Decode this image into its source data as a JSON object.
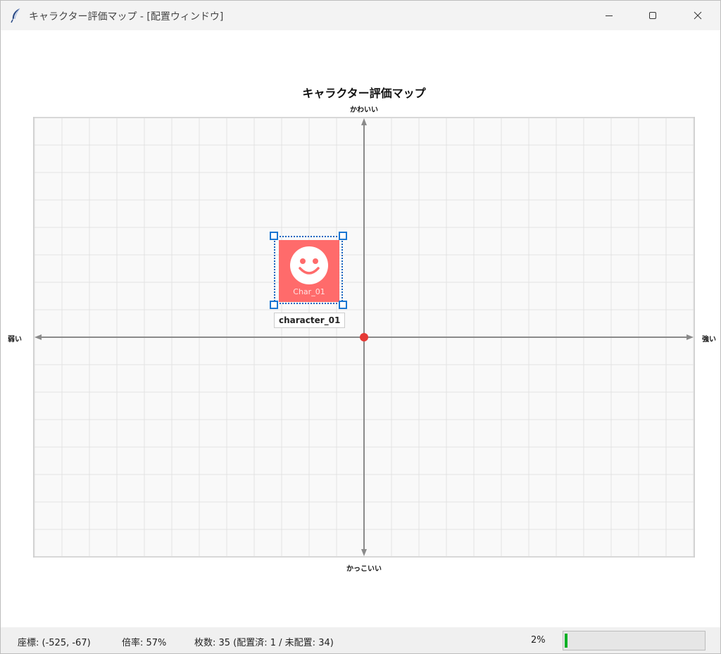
{
  "window": {
    "title": "キャラクター評価マップ - [配置ウィンドウ]",
    "icon": "feather-icon",
    "controls": [
      "minimize-icon",
      "maximize-icon",
      "close-icon"
    ]
  },
  "map": {
    "title": "キャラクター評価マップ",
    "axis_top": "かわいい",
    "axis_bottom": "かっこいい",
    "axis_left": "弱い",
    "axis_right": "強い",
    "origin_color": "#e53935",
    "grid_color": "#e2e2e2",
    "axis_color": "#8a8a8a"
  },
  "character": {
    "caption": "Char_01",
    "name": "character_01",
    "icon": "smiley-face-icon",
    "card_color": "#ff6b6b",
    "selection_color": "#1976d2"
  },
  "status": {
    "coords": "座標: (-525, -67)",
    "zoom": "倍率: 57%",
    "count": "枚数: 35 (配置済: 1 / 未配置: 34)",
    "progress_text": "2%",
    "progress_value": 0.02,
    "progress_color": "#06b025"
  }
}
